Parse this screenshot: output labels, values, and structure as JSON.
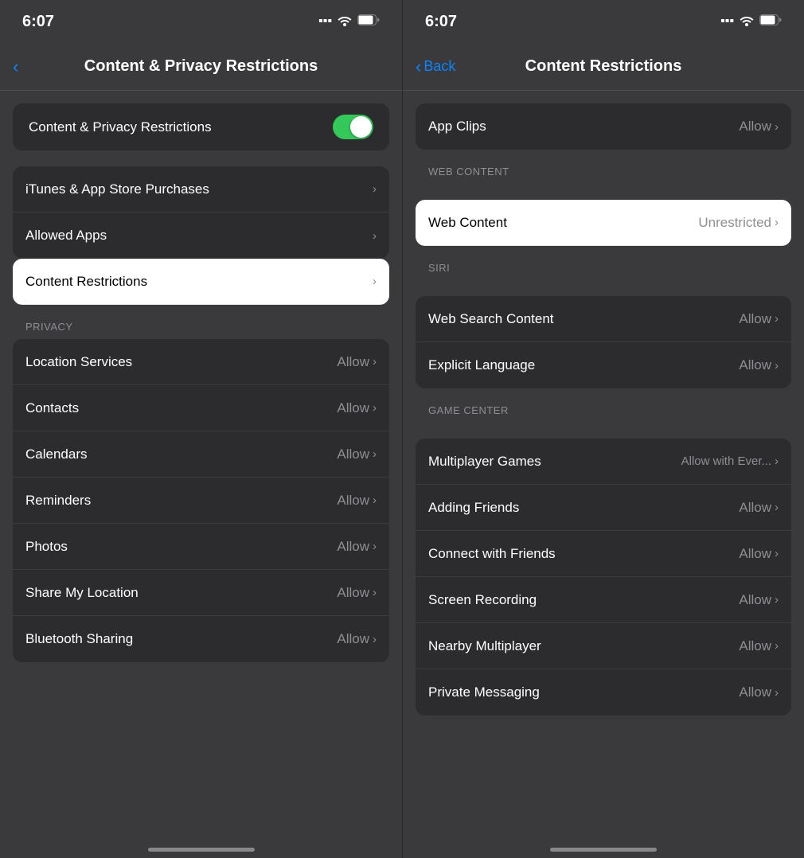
{
  "left": {
    "statusBar": {
      "time": "6:07"
    },
    "navBar": {
      "title": "Content & Privacy Restrictions",
      "backIcon": "‹"
    },
    "toggleSection": {
      "label": "Content & Privacy Restrictions",
      "enabled": true
    },
    "mainItems": [
      {
        "label": "iTunes & App Store Purchases",
        "value": "",
        "hasChevron": true
      },
      {
        "label": "Allowed Apps",
        "value": "",
        "hasChevron": true
      }
    ],
    "highlightedItem": {
      "label": "Content Restrictions",
      "value": "",
      "hasChevron": true
    },
    "privacyHeader": "PRIVACY",
    "privacyItems": [
      {
        "label": "Location Services",
        "value": "Allow",
        "hasChevron": true
      },
      {
        "label": "Contacts",
        "value": "Allow",
        "hasChevron": true
      },
      {
        "label": "Calendars",
        "value": "Allow",
        "hasChevron": true
      },
      {
        "label": "Reminders",
        "value": "Allow",
        "hasChevron": true
      },
      {
        "label": "Photos",
        "value": "Allow",
        "hasChevron": true
      },
      {
        "label": "Share My Location",
        "value": "Allow",
        "hasChevron": true
      },
      {
        "label": "Bluetooth Sharing",
        "value": "Allow",
        "hasChevron": true
      }
    ]
  },
  "right": {
    "statusBar": {
      "time": "6:07"
    },
    "navBar": {
      "back": "Back",
      "title": "Content Restrictions"
    },
    "topItem": {
      "label": "App Clips",
      "value": "Allow",
      "hasChevron": true
    },
    "webContentHeader": "WEB CONTENT",
    "highlightedItem": {
      "label": "Web Content",
      "value": "Unrestricted",
      "hasChevron": true
    },
    "siriHeader": "SIRI",
    "siriItems": [
      {
        "label": "Web Search Content",
        "value": "Allow",
        "hasChevron": true
      },
      {
        "label": "Explicit Language",
        "value": "Allow",
        "hasChevron": true
      }
    ],
    "gameCenterHeader": "GAME CENTER",
    "gameCenterItems": [
      {
        "label": "Multiplayer Games",
        "value": "Allow with Ever...",
        "hasChevron": true
      },
      {
        "label": "Adding Friends",
        "value": "Allow",
        "hasChevron": true
      },
      {
        "label": "Connect with Friends",
        "value": "Allow",
        "hasChevron": true
      },
      {
        "label": "Screen Recording",
        "value": "Allow",
        "hasChevron": true
      },
      {
        "label": "Nearby Multiplayer",
        "value": "Allow",
        "hasChevron": true
      },
      {
        "label": "Private Messaging",
        "value": "Allow",
        "hasChevron": true
      }
    ]
  }
}
